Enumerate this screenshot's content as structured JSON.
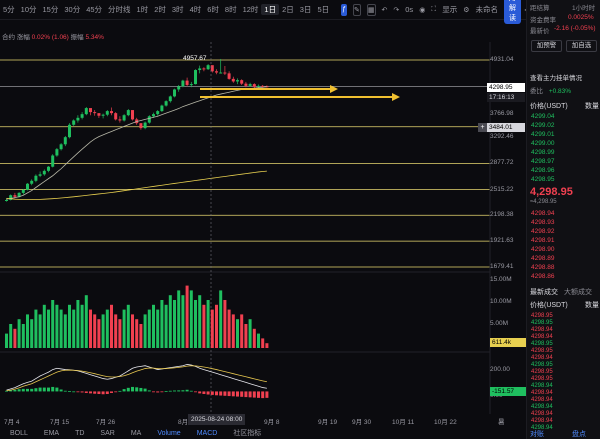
{
  "toolbar": {
    "timeframes": [
      "5分",
      "10分",
      "15分",
      "30分",
      "45分",
      "分时线",
      "1时",
      "2时",
      "3时",
      "4时",
      "6时",
      "8时",
      "12时",
      "1日",
      "2日",
      "3日",
      "5日"
    ],
    "active_timeframe": "1日",
    "zero_s": "0s",
    "display_label": "显示",
    "unnamed_label": "未命名",
    "ai_label": "AI解读"
  },
  "subline": {
    "name": "合约",
    "change_label": "涨幅",
    "change_value": "0.02% (1.06)",
    "amp_label": "振幅",
    "amp_value": "5.34%"
  },
  "chart": {
    "price_ticks": [
      "4931.04",
      "3766.98",
      "3292.46",
      "2877.72",
      "2515.22",
      "2198.38",
      "1921.63",
      "1679.41"
    ],
    "current_price": "4298.95",
    "countdown": "17:16:13",
    "line_label": "3484.01",
    "high_annotation": "4957.67",
    "volume_ticks": [
      "15.00M",
      "10.00M",
      "5.00M"
    ],
    "volume_value": "611.4k",
    "macd_ticks": [
      "200.00",
      "0.00"
    ],
    "macd_value": "-151.57",
    "x_ticks": [
      "7月 4",
      "7月 15",
      "7月 26",
      "8月",
      "9月 8",
      "9月 19",
      "9月 30",
      "10月 11",
      "10月 22",
      "暑"
    ],
    "crosshair_date": "2025-08-24 08:00"
  },
  "chart_data": [
    {
      "type": "candlestick",
      "candles": [
        [
          2378,
          2402,
          2360,
          2380
        ],
        [
          2380,
          2450,
          2375,
          2440
        ],
        [
          2440,
          2470,
          2400,
          2420
        ],
        [
          2420,
          2480,
          2410,
          2470
        ],
        [
          2470,
          2520,
          2450,
          2510
        ],
        [
          2510,
          2600,
          2500,
          2590
        ],
        [
          2590,
          2650,
          2570,
          2630
        ],
        [
          2630,
          2720,
          2610,
          2700
        ],
        [
          2700,
          2760,
          2680,
          2720
        ],
        [
          2720,
          2790,
          2700,
          2770
        ],
        [
          2770,
          2840,
          2750,
          2830
        ],
        [
          2830,
          3020,
          2820,
          3000
        ],
        [
          3000,
          3120,
          2980,
          3100
        ],
        [
          3100,
          3200,
          3080,
          3180
        ],
        [
          3180,
          3320,
          3150,
          3300
        ],
        [
          3300,
          3550,
          3280,
          3520
        ],
        [
          3520,
          3620,
          3500,
          3600
        ],
        [
          3600,
          3700,
          3560,
          3650
        ],
        [
          3650,
          3760,
          3620,
          3720
        ],
        [
          3720,
          3860,
          3700,
          3840
        ],
        [
          3840,
          3780,
          3700,
          3760
        ],
        [
          3760,
          3800,
          3690,
          3740
        ],
        [
          3740,
          3720,
          3650,
          3690
        ],
        [
          3690,
          3730,
          3640,
          3710
        ],
        [
          3710,
          3800,
          3680,
          3780
        ],
        [
          3780,
          3850,
          3700,
          3740
        ],
        [
          3740,
          3760,
          3600,
          3620
        ],
        [
          3620,
          3680,
          3560,
          3600
        ],
        [
          3600,
          3720,
          3580,
          3700
        ],
        [
          3700,
          3820,
          3680,
          3800
        ],
        [
          3800,
          3760,
          3600,
          3620
        ],
        [
          3620,
          3650,
          3520,
          3550
        ],
        [
          3550,
          3520,
          3430,
          3460
        ],
        [
          3460,
          3580,
          3440,
          3560
        ],
        [
          3560,
          3700,
          3540,
          3680
        ],
        [
          3680,
          3750,
          3650,
          3720
        ],
        [
          3720,
          3800,
          3690,
          3780
        ],
        [
          3780,
          3910,
          3760,
          3890
        ],
        [
          3890,
          4000,
          3870,
          3980
        ],
        [
          3980,
          4100,
          3950,
          4080
        ],
        [
          4080,
          4250,
          4060,
          4230
        ],
        [
          4230,
          4330,
          4180,
          4300
        ],
        [
          4300,
          4450,
          4280,
          4430
        ],
        [
          4430,
          4500,
          4300,
          4330
        ],
        [
          4330,
          4400,
          4280,
          4350
        ],
        [
          4350,
          4700,
          4340,
          4680
        ],
        [
          4680,
          4790,
          4600,
          4720
        ],
        [
          4720,
          4750,
          4650,
          4700
        ],
        [
          4700,
          4830,
          4680,
          4800
        ],
        [
          4800,
          4790,
          4620,
          4650
        ],
        [
          4650,
          4700,
          4580,
          4620
        ],
        [
          4620,
          4957.67,
          4600,
          4620
        ],
        [
          4620,
          4780,
          4560,
          4600
        ],
        [
          4600,
          4650,
          4450,
          4470
        ],
        [
          4470,
          4520,
          4380,
          4410
        ],
        [
          4410,
          4480,
          4350,
          4440
        ],
        [
          4440,
          4460,
          4330,
          4360
        ],
        [
          4360,
          4400,
          4280,
          4310
        ],
        [
          4310,
          4380,
          4290,
          4350
        ],
        [
          4350,
          4370,
          4260,
          4290
        ],
        [
          4290,
          4340,
          4270,
          4310
        ],
        [
          4310,
          4330,
          4270,
          4300
        ],
        [
          4300,
          4320,
          4280,
          4298.95
        ]
      ],
      "ma_long": [
        2390,
        2400,
        2410,
        2420,
        2440,
        2470,
        2500,
        2540,
        2580,
        2620,
        2660,
        2700,
        2750,
        2800,
        2860,
        2920,
        2980,
        3040,
        3100,
        3160,
        3220,
        3270,
        3310,
        3340,
        3370,
        3400,
        3430,
        3460,
        3490,
        3520,
        3550,
        3580,
        3600,
        3620,
        3640,
        3660,
        3680,
        3710,
        3740,
        3770,
        3800,
        3830,
        3870,
        3900,
        3930,
        3960,
        3990,
        4020,
        4050,
        4080,
        4110,
        4130,
        4150,
        4170,
        4190,
        4210,
        4230,
        4240,
        4250,
        4260,
        4270,
        4280,
        4290
      ],
      "ma_200": [
        2400,
        2395,
        2390,
        2388,
        2386,
        2385,
        2385,
        2386,
        2388,
        2390,
        2393,
        2396,
        2400,
        2405,
        2410,
        2415,
        2420,
        2426,
        2432,
        2438,
        2444,
        2450,
        2456,
        2462,
        2468,
        2475,
        2482,
        2490,
        2498,
        2506,
        2514,
        2522,
        2530,
        2538,
        2546,
        2554,
        2562,
        2570,
        2578,
        2586,
        2594,
        2602,
        2610,
        2618,
        2626,
        2634,
        2642,
        2650,
        2658,
        2666,
        2674,
        2682,
        2690,
        2698,
        2706,
        2714,
        2722,
        2730,
        2738,
        2746,
        2754,
        2760,
        2766
      ],
      "horizontal_levels": [
        4931.04,
        4298.95,
        3484.01,
        2877.72,
        2515.22,
        1679.41
      ]
    },
    {
      "type": "bar",
      "series": [
        {
          "name": "volume",
          "values": [
            3,
            5,
            4,
            6,
            5,
            7,
            6,
            8,
            7,
            9,
            8,
            10,
            9,
            8,
            7,
            9,
            8,
            10,
            9,
            11,
            8,
            7,
            6,
            7,
            8,
            9,
            7,
            6,
            8,
            9,
            7,
            6,
            5,
            7,
            8,
            9,
            8,
            10,
            9,
            11,
            10,
            12,
            11,
            13,
            12,
            10,
            11,
            9,
            10,
            8,
            9,
            12,
            10,
            8,
            7,
            6,
            7,
            5,
            6,
            4,
            3,
            2,
            1
          ]
        }
      ],
      "ylim": [
        0,
        15
      ]
    },
    {
      "type": "line",
      "series": [
        {
          "name": "DIF",
          "values": [
            10,
            20,
            30,
            45,
            60,
            70,
            80,
            100,
            120,
            135,
            150,
            170,
            180,
            175,
            170,
            168,
            165,
            160,
            150,
            140,
            130,
            120,
            110,
            100,
            95,
            100,
            110,
            120,
            140,
            160,
            180,
            190,
            195,
            200,
            190,
            180,
            170,
            175,
            180,
            185,
            190,
            195,
            200,
            210,
            205,
            195,
            180,
            170,
            160,
            150,
            140,
            130,
            120,
            110,
            100,
            90,
            80,
            70,
            60,
            50,
            40,
            30,
            25
          ]
        },
        {
          "name": "DEA",
          "values": [
            5,
            10,
            18,
            28,
            40,
            50,
            60,
            75,
            90,
            105,
            120,
            135,
            150,
            160,
            165,
            166,
            165,
            163,
            158,
            152,
            145,
            138,
            130,
            122,
            115,
            112,
            113,
            116,
            122,
            132,
            145,
            158,
            168,
            178,
            182,
            181,
            178,
            177,
            178,
            180,
            183,
            187,
            191,
            197,
            200,
            199,
            195,
            190,
            184,
            177,
            170,
            162,
            154,
            146,
            138,
            130,
            122,
            114,
            106,
            98,
            90,
            82,
            75
          ]
        }
      ],
      "ylim": [
        -160,
        260
      ]
    }
  ],
  "panel": {
    "countdown_label": "距结算",
    "countdown_value": "1小时时",
    "funding_label": "资金费率",
    "funding_value": "0.0025%",
    "change_label": "最新价",
    "change_value": "-2.16 (-0.05%)",
    "add_alert": "加预警",
    "add_watch": "加自选",
    "flow_title": "查看主力挂单情况",
    "ratio_label": "委比",
    "ratio_value": "+0.83%",
    "col_price": "价格(USDT)",
    "col_qty": "数量",
    "asks": [
      "4299.04",
      "4299.02",
      "4299.01",
      "4299.00",
      "4298.99",
      "4298.97",
      "4298.96",
      "4298.95"
    ],
    "last_price": "4,298.95",
    "last_price_sub": "≈4,298.95",
    "bids": [
      "4298.94",
      "4298.93",
      "4298.92",
      "4298.91",
      "4298.90",
      "4298.89",
      "4298.88",
      "4298.86"
    ],
    "trades_title": "最新成交",
    "big_trades": "大额成交",
    "trades_col": "价格(USDT)",
    "trade_prices": [
      "4298.95",
      "4298.95",
      "4298.94",
      "4298.94",
      "4298.95",
      "4298.95",
      "4298.94",
      "4298.95",
      "4298.95",
      "4298.95",
      "4298.94",
      "4298.94",
      "4298.94",
      "4298.94",
      "4298.94",
      "4298.94",
      "4298.94"
    ],
    "bottom_left": "对账",
    "bottom_right": "盘点"
  },
  "indicators": [
    "BOLL",
    "EMA",
    "TD",
    "SAR",
    "MA",
    "Volume",
    "MACD",
    "社区指标"
  ],
  "active_indicators": [
    "Volume",
    "MACD"
  ],
  "colors": {
    "up": "#1fbf5f",
    "down": "#f04050",
    "accent": "#2a5bd7",
    "level": "#e8d870",
    "arrow": "#f0c030"
  }
}
